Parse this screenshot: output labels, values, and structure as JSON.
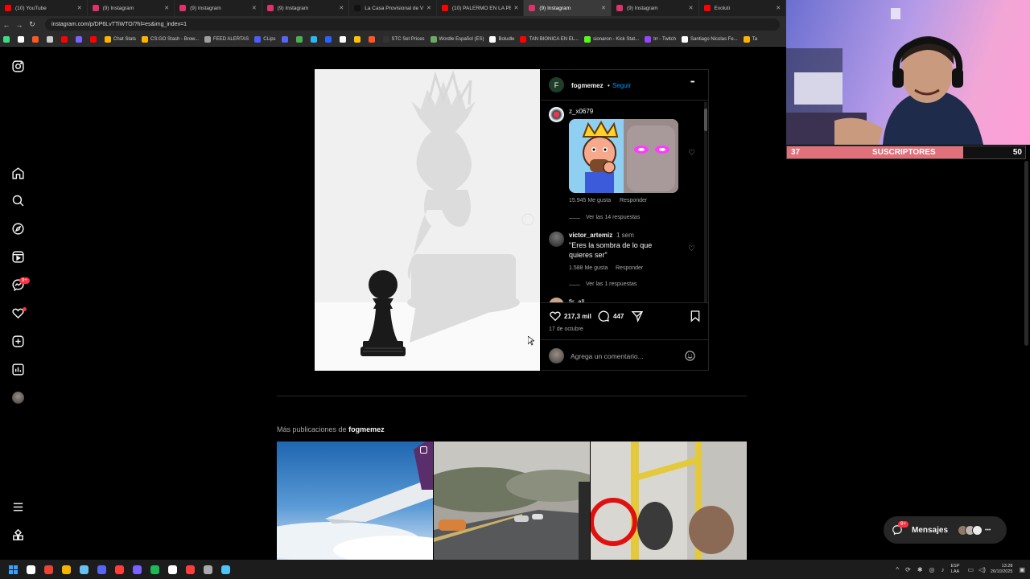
{
  "tabs": [
    {
      "label": "(10) YouTube",
      "color": "#ff0000"
    },
    {
      "label": "(9) Instagram",
      "color": "#e1306c"
    },
    {
      "label": "(9) Instagram",
      "color": "#e1306c"
    },
    {
      "label": "(9) Instagram",
      "color": "#e1306c"
    },
    {
      "label": "La Casa Provisional de Veget...",
      "color": "#111111"
    },
    {
      "label": "(10) PALERMO EN LA PERA -...",
      "color": "#ff0000"
    },
    {
      "label": "(9) Instagram",
      "color": "#e1306c",
      "active": true
    },
    {
      "label": "(9) Instagram",
      "color": "#e1306c"
    },
    {
      "label": "Evoluti",
      "color": "#ff0000"
    }
  ],
  "address": {
    "url": "instagram.com/p/DP6LvTTiWTO/?hl=es&img_index=1"
  },
  "bookmarks": [
    {
      "label": "",
      "color": "#3ddc84"
    },
    {
      "label": "",
      "color": "#ffffff"
    },
    {
      "label": "",
      "color": "#ff5722"
    },
    {
      "label": "",
      "color": "#cccccc"
    },
    {
      "label": "",
      "color": "#ff0000"
    },
    {
      "label": "",
      "color": "#7b61ff"
    },
    {
      "label": "",
      "color": "#ff0000"
    },
    {
      "label": "Chat Stats",
      "color": "#ffb300"
    },
    {
      "label": "CS:GO Stash - Brow...",
      "color": "#ffb300"
    },
    {
      "label": "FEED ALERTAS",
      "color": "#9e9e9e"
    },
    {
      "label": "CLips",
      "color": "#4a5cff"
    },
    {
      "label": "",
      "color": "#5865f2"
    },
    {
      "label": "",
      "color": "#4caf50"
    },
    {
      "label": "",
      "color": "#29b6f6"
    },
    {
      "label": "",
      "color": "#2962ff"
    },
    {
      "label": "",
      "color": "#ffffff"
    },
    {
      "label": "",
      "color": "#ffc107"
    },
    {
      "label": "",
      "color": "#ff5722"
    },
    {
      "label": "STC Set Prices",
      "color": "#333333"
    },
    {
      "label": "Wordle Español (ES)",
      "color": "#6aaa64"
    },
    {
      "label": "Boludle",
      "color": "#ffffff"
    },
    {
      "label": "TAN BIONICA EN EL...",
      "color": "#ff0000"
    },
    {
      "label": "sionaron - Kick Stat...",
      "color": "#53fc18"
    },
    {
      "label": "trr - Twitch",
      "color": "#9146ff"
    },
    {
      "label": "Santiago Nicolas Fe...",
      "color": "#ffffff"
    },
    {
      "label": "Ta",
      "color": "#ffb300"
    }
  ],
  "post": {
    "author_initial": "F",
    "author": "fogmemez",
    "separator": "•",
    "follow": "Seguir",
    "more": "•••",
    "comments": [
      {
        "user": "z_x0679",
        "likes": "15.945 Me gusta",
        "reply": "Responder",
        "view_replies": "Ver las 14 respuestas"
      },
      {
        "user": "victor_artemiz",
        "time": "1 sem",
        "text": "\"Eres la sombra de lo que quieres ser\"",
        "likes": "1.588 Me gusta",
        "reply": "Responder",
        "view_replies": "Ver las 1 respuestas"
      },
      {
        "user": "fir_all"
      }
    ],
    "like_count": "217,3 mil",
    "comment_count": "447",
    "date": "17 de octubre",
    "add_comment_placeholder": "Agrega un comentario..."
  },
  "more_posts": {
    "prefix": "Más publicaciones de",
    "author": "fogmemez"
  },
  "messages": {
    "label": "Mensajes",
    "badge": "9+"
  },
  "nav": {
    "notifications_badge": "9+"
  },
  "overlay": {
    "subs_current": "37",
    "subs_label": "SUSCRIPTORES",
    "subs_goal": "50",
    "progress": 0.74
  },
  "taskbar": {
    "lang_top": "ESP",
    "lang_bottom": "LAA",
    "time": "13:28",
    "date": "26/10/2025",
    "apps": [
      "#ffffff",
      "#ea4335",
      "#f4b400",
      "#66c0f4",
      "#5865f2",
      "#ff3d3d",
      "#7b61ff",
      "#1db954",
      "#ffffff",
      "#ff3d3d",
      "#aaaaaa",
      "#4fc3f7"
    ]
  }
}
